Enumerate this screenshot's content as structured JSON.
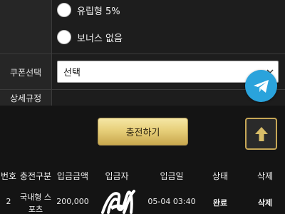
{
  "options": {
    "items": [
      {
        "label": "유립형 5%"
      },
      {
        "label": "보너스 없음"
      }
    ]
  },
  "coupon": {
    "label": "쿠폰선택",
    "selected": "선택"
  },
  "details": {
    "label": "상세규정"
  },
  "actions": {
    "charge_label": "충전하기"
  },
  "table": {
    "headers": [
      "번호",
      "충전구분",
      "입금금액",
      "입금자",
      "입금일",
      "상태",
      "삭제"
    ],
    "rows": [
      {
        "no": "2",
        "type": "국내형 스포츠",
        "amount": "200,000",
        "depositor": "",
        "date": "05-04 03:40",
        "status": "완료",
        "delete": "삭제"
      }
    ]
  },
  "icons": {
    "telegram": "telegram-icon",
    "scroll_top": "arrow-up-icon",
    "select_arrow": "chevron-down-icon"
  },
  "colors": {
    "background": "#141414",
    "accent_gold": "#d8bd68",
    "telegram_blue": "#2aa3dc"
  }
}
